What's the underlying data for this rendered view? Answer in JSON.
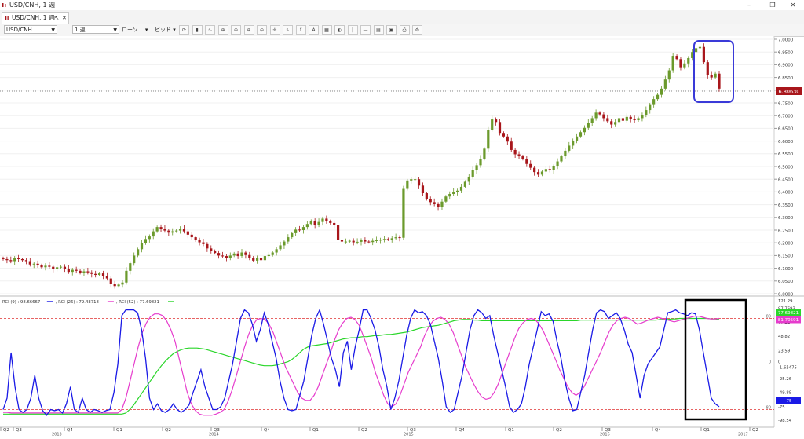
{
  "window": {
    "title": "USD/CNH, 1 週",
    "minimize": "–",
    "maximize": "❐",
    "close": "✕"
  },
  "tab": {
    "label": "USD/CNH, 1 週",
    "detach": "⇱",
    "close": "✕"
  },
  "toolbar": {
    "symbol": "USD/CNH",
    "timeframe": "1 週",
    "chart_type": "ローソ...",
    "price_side": "ビッド",
    "buttons": [
      "refresh",
      "bar-chart",
      "line-chart",
      "zoom-in",
      "zoom-out",
      "zoom-in-2",
      "zoom-out-2",
      "crosshair",
      "cursor",
      "indicator-fx",
      "indicator-abc",
      "candle-style",
      "color-scheme",
      "vertical-line",
      "horizontal-line",
      "grid",
      "template",
      "screenshot",
      "settings"
    ]
  },
  "price_axis": {
    "labels": [
      "7.0000",
      "6.9500",
      "6.9000",
      "6.8500",
      "6.8000",
      "6.7500",
      "6.7000",
      "6.6500",
      "6.6000",
      "6.5500",
      "6.5000",
      "6.4500",
      "6.4000",
      "6.3500",
      "6.3000",
      "6.2500",
      "6.2000",
      "6.1500",
      "6.1000",
      "6.0500",
      "6.0000"
    ],
    "current_price": "6.80630"
  },
  "indicator": {
    "legend": [
      {
        "text": "RCI (9) : 98.66667",
        "color": "#1a1ae6"
      },
      {
        "text": ", RCI (26) : 79.48718",
        "color": "#e63ccd"
      },
      {
        "text": ", RCI (52) : 77.69821",
        "color": "#2bd62b"
      }
    ],
    "axis_labels": [
      "121.29",
      "97.7693",
      "72.44",
      "48.82",
      "23.59",
      "0",
      "-1.65475",
      "-25.26",
      "-49.89",
      "-75",
      "-98.54"
    ],
    "tags": {
      "green": "77.69821",
      "magenta": "81.70591",
      "blue": "-75"
    },
    "level_labels": {
      "upper": "80",
      "zero": "0",
      "lower": "-80"
    }
  },
  "time_axis": {
    "quarters": [
      "Q2",
      "Q3",
      "Q4",
      "Q1",
      "Q2",
      "Q3",
      "Q4",
      "Q1",
      "Q2",
      "Q3",
      "Q4",
      "Q1",
      "Q2",
      "Q3",
      "Q4",
      "Q1",
      "Q2"
    ],
    "years": [
      "2013",
      "2014",
      "2015",
      "2016",
      "2017"
    ]
  },
  "colors": {
    "bull": "#6b9a2c",
    "bear": "#a8161b",
    "rci9": "#1a1ae6",
    "rci26": "#e63ccd",
    "rci52": "#2bd62b",
    "box_blue": "#3a3ad8",
    "box_black": "#000000",
    "level": "#e03030"
  },
  "chart_data": {
    "type": "candlestick",
    "timeframe": "weekly",
    "ylim": [
      6.0,
      7.0
    ],
    "close": [
      6.136,
      6.132,
      6.128,
      6.14,
      6.136,
      6.132,
      6.128,
      6.115,
      6.118,
      6.112,
      6.104,
      6.11,
      6.106,
      6.098,
      6.104,
      6.106,
      6.098,
      6.086,
      6.094,
      6.09,
      6.082,
      6.088,
      6.084,
      6.078,
      6.074,
      6.08,
      6.07,
      6.06,
      6.038,
      6.03,
      6.036,
      6.044,
      6.09,
      6.12,
      6.15,
      6.175,
      6.2,
      6.215,
      6.225,
      6.245,
      6.262,
      6.255,
      6.248,
      6.24,
      6.245,
      6.248,
      6.255,
      6.245,
      6.232,
      6.222,
      6.21,
      6.202,
      6.195,
      6.178,
      6.168,
      6.16,
      6.15,
      6.148,
      6.142,
      6.15,
      6.158,
      6.148,
      6.162,
      6.152,
      6.142,
      6.13,
      6.14,
      6.132,
      6.148,
      6.152,
      6.162,
      6.175,
      6.19,
      6.205,
      6.222,
      6.238,
      6.252,
      6.25,
      6.262,
      6.274,
      6.286,
      6.27,
      6.282,
      6.295,
      6.285,
      6.278,
      6.27,
      6.21,
      6.205,
      6.205,
      6.208,
      6.202,
      6.204,
      6.21,
      6.205,
      6.203,
      6.208,
      6.21,
      6.212,
      6.215,
      6.213,
      6.218,
      6.222,
      6.22,
      6.412,
      6.445,
      6.45,
      6.45,
      6.425,
      6.395,
      6.372,
      6.36,
      6.352,
      6.34,
      6.362,
      6.382,
      6.392,
      6.4,
      6.405,
      6.42,
      6.44,
      6.46,
      6.485,
      6.505,
      6.53,
      6.57,
      6.645,
      6.685,
      6.675,
      6.632,
      6.618,
      6.598,
      6.565,
      6.548,
      6.54,
      6.53,
      6.51,
      6.495,
      6.478,
      6.468,
      6.48,
      6.49,
      6.485,
      6.5,
      6.52,
      6.54,
      6.562,
      6.582,
      6.602,
      6.618,
      6.635,
      6.652,
      6.672,
      6.69,
      6.712,
      6.705,
      6.69,
      6.678,
      6.665,
      6.675,
      6.69,
      6.68,
      6.695,
      6.688,
      6.682,
      6.69,
      6.702,
      6.722,
      6.742,
      6.765,
      6.782,
      6.806,
      6.842,
      6.878,
      6.935,
      6.922,
      6.89,
      6.905,
      6.926,
      6.95,
      6.965,
      6.97,
      6.91,
      6.86,
      6.85,
      6.865,
      6.806
    ],
    "rci": {
      "rci9_last": 98.66667,
      "rci26_last": 79.48718,
      "rci52_last": 77.69821,
      "rci9": [
        -80,
        -60,
        20,
        -40,
        -80,
        -85,
        -80,
        -60,
        -20,
        -60,
        -82,
        -90,
        -80,
        -82,
        -80,
        -86,
        -70,
        -40,
        -80,
        -85,
        -60,
        -80,
        -85,
        -80,
        -82,
        -85,
        -82,
        -80,
        -50,
        0,
        85,
        95,
        95,
        95,
        90,
        60,
        10,
        -60,
        -80,
        -70,
        -82,
        -85,
        -80,
        -70,
        -80,
        -85,
        -80,
        -72,
        -50,
        -30,
        -10,
        -40,
        -60,
        -80,
        -80,
        -75,
        -60,
        -30,
        0,
        40,
        80,
        95,
        90,
        70,
        40,
        60,
        90,
        70,
        40,
        10,
        -30,
        -60,
        -80,
        -82,
        -80,
        -55,
        -30,
        10,
        50,
        80,
        95,
        70,
        40,
        10,
        -10,
        -40,
        20,
        40,
        -10,
        30,
        60,
        95,
        95,
        80,
        60,
        30,
        -10,
        -40,
        -80,
        -60,
        -30,
        10,
        50,
        80,
        95,
        90,
        92,
        85,
        70,
        40,
        10,
        -30,
        -75,
        -85,
        -80,
        -50,
        -20,
        20,
        60,
        85,
        95,
        90,
        80,
        85,
        50,
        20,
        -10,
        -40,
        -75,
        -85,
        -80,
        -70,
        -40,
        0,
        30,
        60,
        92,
        85,
        88,
        75,
        40,
        10,
        -30,
        -60,
        -82,
        -80,
        -50,
        -20,
        20,
        60,
        90,
        95,
        92,
        80,
        85,
        90,
        80,
        60,
        35,
        20,
        -20,
        -60,
        -20,
        0,
        10,
        20,
        30,
        60,
        90,
        92,
        95,
        90,
        88,
        85,
        90,
        88,
        60,
        20,
        -20,
        -60,
        -70,
        -75
      ],
      "rci26": [
        -85,
        -85,
        -86,
        -86,
        -86,
        -86,
        -86,
        -86,
        -86,
        -86,
        -86,
        -86,
        -86,
        -86,
        -86,
        -86,
        -86,
        -86,
        -86,
        -86,
        -86,
        -86,
        -86,
        -86,
        -86,
        -86,
        -86,
        -86,
        -86,
        -80,
        -60,
        -30,
        0,
        30,
        55,
        72,
        83,
        88,
        88,
        85,
        75,
        60,
        40,
        10,
        -20,
        -50,
        -70,
        -82,
        -88,
        -90,
        -90,
        -90,
        -88,
        -85,
        -80,
        -65,
        -45,
        -20,
        5,
        30,
        52,
        68,
        78,
        80,
        78,
        70,
        55,
        35,
        15,
        -5,
        -20,
        -35,
        -50,
        -60,
        -64,
        -64,
        -55,
        -40,
        -20,
        0,
        20,
        42,
        60,
        72,
        80,
        82,
        78,
        68,
        50,
        30,
        10,
        -15,
        -35,
        -55,
        -70,
        -75,
        -70,
        -55,
        -35,
        -15,
        0,
        15,
        30,
        50,
        65,
        75,
        80,
        82,
        78,
        70,
        55,
        35,
        15,
        -5,
        -20,
        -35,
        -48,
        -58,
        -62,
        -60,
        -50,
        -35,
        -15,
        5,
        25,
        45,
        62,
        72,
        78,
        80,
        78,
        70,
        58,
        42,
        25,
        8,
        -10,
        -25,
        -40,
        -50,
        -55,
        -50,
        -40,
        -25,
        -10,
        5,
        20,
        38,
        55,
        68,
        76,
        80,
        82,
        80,
        75,
        70,
        72,
        75,
        78,
        80,
        82,
        80,
        78,
        76,
        74,
        76,
        78,
        80,
        82,
        84,
        84,
        82,
        80,
        79,
        79,
        80
      ],
      "rci52": [
        -88,
        -88,
        -88,
        -88,
        -88,
        -88,
        -88,
        -88,
        -88,
        -88,
        -88,
        -88,
        -88,
        -88,
        -88,
        -88,
        -88,
        -88,
        -88,
        -88,
        -88,
        -88,
        -88,
        -88,
        -88,
        -88,
        -88,
        -88,
        -88,
        -88,
        -88,
        -86,
        -80,
        -72,
        -62,
        -52,
        -42,
        -32,
        -22,
        -12,
        -3,
        5,
        12,
        18,
        22,
        25,
        27,
        28,
        28,
        28,
        27,
        26,
        24,
        22,
        20,
        18,
        16,
        14,
        12,
        10,
        8,
        6,
        4,
        2,
        0,
        -2,
        -3,
        -3,
        -3,
        -2,
        0,
        2,
        4,
        8,
        14,
        20,
        26,
        30,
        32,
        33,
        34,
        35,
        36,
        38,
        40,
        42,
        44,
        45,
        46,
        46,
        47,
        48,
        48,
        49,
        50,
        50,
        51,
        52,
        52,
        53,
        54,
        55,
        56,
        58,
        60,
        62,
        64,
        65,
        66,
        67,
        68,
        70,
        72,
        74,
        76,
        77,
        78,
        78,
        78,
        77,
        77,
        76,
        76,
        76,
        76,
        76,
        76,
        76,
        76,
        76,
        76,
        76,
        76,
        76,
        76,
        76,
        76,
        76,
        76,
        76,
        76,
        76,
        76,
        76,
        76,
        76,
        77,
        77,
        77,
        77,
        77,
        77,
        77,
        77,
        77,
        77,
        77,
        77,
        77,
        77,
        77,
        77,
        77,
        77,
        77,
        77,
        78,
        78,
        78,
        79,
        79,
        80,
        80,
        80,
        80,
        80,
        80,
        80,
        80,
        79,
        79,
        78
      ]
    }
  }
}
